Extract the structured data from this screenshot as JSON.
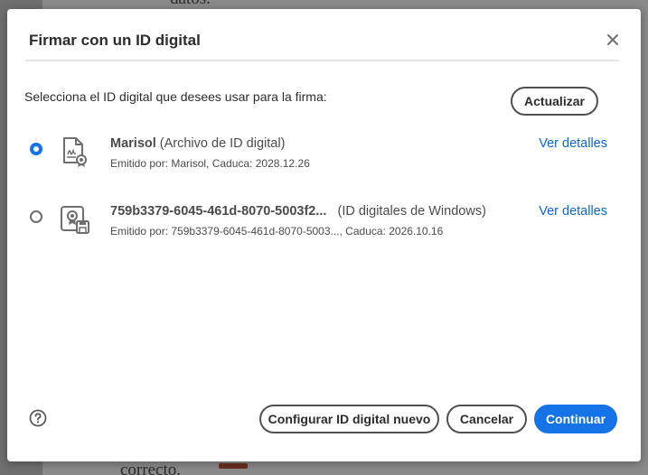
{
  "background": {
    "top_text": "datos.",
    "bottom_text": "correcto."
  },
  "dialog": {
    "title": "Firmar con un ID digital",
    "close_icon": "close-icon",
    "instruction": "Selecciona el ID digital que desees usar para la firma:",
    "refresh_label": "Actualizar",
    "ids": [
      {
        "name": "Marisol",
        "type": " (Archivo de ID digital)",
        "subtitle": "Emitido por: Marisol, Caduca: 2028.12.26",
        "details_label": "Ver detalles",
        "selected": true,
        "icon": "certificate-file-icon"
      },
      {
        "name": "759b3379-6045-461d-8070-5003f2...",
        "type": "   (ID digitales de Windows)",
        "subtitle": "Emitido por: 759b3379-6045-461d-8070-5003..., Caduca: 2026.10.16",
        "details_label": "Ver detalles",
        "selected": false,
        "icon": "windows-certificate-icon"
      }
    ],
    "help_icon": "help-icon",
    "configure_label": "Configurar ID digital nuevo",
    "cancel_label": "Cancelar",
    "continue_label": "Continuar"
  },
  "colors": {
    "accent": "#1473e6",
    "link": "#0d66d0",
    "overlay": "#6f6f6f"
  }
}
